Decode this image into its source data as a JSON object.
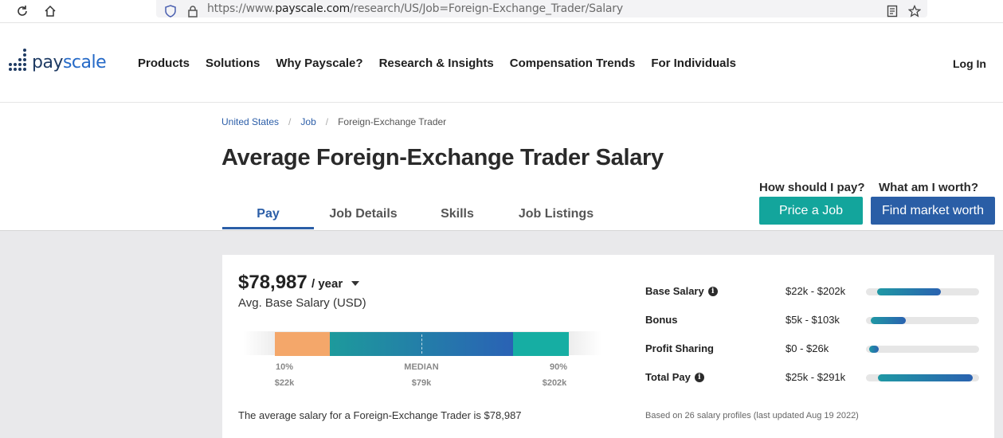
{
  "browser": {
    "url_prefix": "https://www.",
    "url_host": "payscale.com",
    "url_path": "/research/US/Job=Foreign-Exchange_Trader/Salary"
  },
  "header": {
    "logo_pay": "pay",
    "logo_scale": "scale",
    "nav": [
      "Products",
      "Solutions",
      "Why Payscale?",
      "Research & Insights",
      "Compensation Trends",
      "For Individuals"
    ],
    "login": "Log In"
  },
  "breadcrumb": {
    "items": [
      "United States",
      "Job"
    ],
    "separator": "/",
    "current": "Foreign-Exchange Trader"
  },
  "page_title": "Average Foreign-Exchange Trader Salary",
  "tabs": [
    "Pay",
    "Job Details",
    "Skills",
    "Job Listings"
  ],
  "active_tab": "Pay",
  "cta": {
    "price_question": "How should I pay?",
    "price_button": "Price a Job",
    "worth_question": "What am I worth?",
    "worth_button": "Find market worth"
  },
  "salary": {
    "amount": "$78,987",
    "period": "/ year",
    "subtitle": "Avg. Base Salary (USD)",
    "percentiles": [
      {
        "label": "10%",
        "value": "$22k"
      },
      {
        "label": "MEDIAN",
        "value": "$79k"
      },
      {
        "label": "90%",
        "value": "$202k"
      }
    ],
    "sentence": "The average salary for a Foreign-Exchange Trader is $78,987"
  },
  "pay_breakdown": {
    "rows": [
      {
        "label": "Base Salary",
        "has_info": true,
        "range": "$22k - $202k",
        "low": 22,
        "high": 202
      },
      {
        "label": "Bonus",
        "has_info": false,
        "range": "$5k - $103k",
        "low": 5,
        "high": 103
      },
      {
        "label": "Profit Sharing",
        "has_info": false,
        "range": "$0 - $26k",
        "low": 0,
        "high": 26
      },
      {
        "label": "Total Pay",
        "has_info": true,
        "range": "$25k - $291k",
        "low": 25,
        "high": 291
      }
    ],
    "footnote": "Based on 26 salary profiles (last updated Aug 19 2022)"
  },
  "colors": {
    "brand_navy": "#1f3b63",
    "brand_blue": "#2a5ea6",
    "teal": "#13a59c",
    "orange": "#f4a76a"
  }
}
